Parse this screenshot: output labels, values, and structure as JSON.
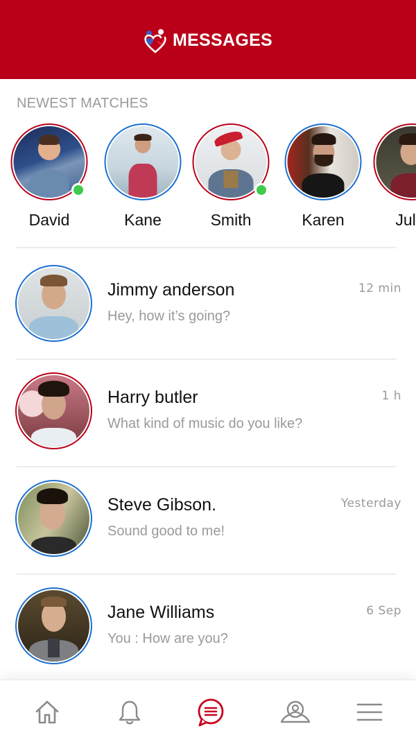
{
  "header": {
    "title": "MESSAGES",
    "logo_icon": "heart-couple-logo-icon",
    "background": "#b90018"
  },
  "newest_matches": {
    "section_title": "NEWEST MATCHES",
    "items": [
      {
        "name": "David",
        "online": true,
        "ring": "#b90018"
      },
      {
        "name": "Kane",
        "online": false,
        "ring": "#1a6fd0"
      },
      {
        "name": "Smith",
        "online": true,
        "ring": "#b90018"
      },
      {
        "name": "Karen",
        "online": false,
        "ring": "#1a6fd0"
      },
      {
        "name": "Julie",
        "online": false,
        "ring": "#b90018"
      }
    ]
  },
  "conversations": [
    {
      "name": "Jimmy anderson",
      "message": "Hey, how it’s going?",
      "time": "12 min",
      "ring": "#1a6fd0"
    },
    {
      "name": "Harry butler",
      "message": "What kind of music do you like?",
      "time": "1 h",
      "ring": "#b90018"
    },
    {
      "name": "Steve Gibson.",
      "message": "Sound good to me!",
      "time": "Yesterday",
      "ring": "#1a6fd0"
    },
    {
      "name": "Jane Williams",
      "message": "You : How are you?",
      "time": "6 Sep",
      "ring": "#1a6fd0"
    }
  ],
  "bottom_nav": {
    "items": [
      {
        "icon": "home-icon",
        "active": false
      },
      {
        "icon": "bell-icon",
        "active": false
      },
      {
        "icon": "chat-bubble-icon",
        "active": true
      },
      {
        "icon": "search-user-icon",
        "active": false
      },
      {
        "icon": "menu-icon",
        "active": false
      }
    ]
  },
  "colors": {
    "accent": "#b90018",
    "ring_blue": "#1a6fd0",
    "online": "#3fcb4d",
    "muted_text": "#9a9a9a"
  }
}
